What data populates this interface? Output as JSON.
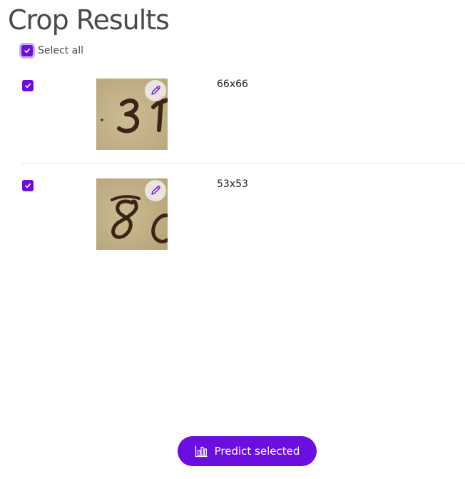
{
  "page": {
    "title": "Crop Results"
  },
  "select_all": {
    "label": "Select all",
    "checked": true
  },
  "crops": [
    {
      "checked": true,
      "dimensions": "66x66",
      "handwritten_digits": "31",
      "edit_icon": "pencil-icon"
    },
    {
      "checked": true,
      "dimensions": "53x53",
      "handwritten_digits": "80",
      "edit_icon": "pencil-icon"
    }
  ],
  "actions": {
    "predict_label": "Predict selected",
    "predict_icon": "bar-chart-icon"
  },
  "colors": {
    "accent": "#6a0fe0",
    "title": "#4a4a4a",
    "paper": "#c3b28a",
    "ink": "#3a2414"
  }
}
